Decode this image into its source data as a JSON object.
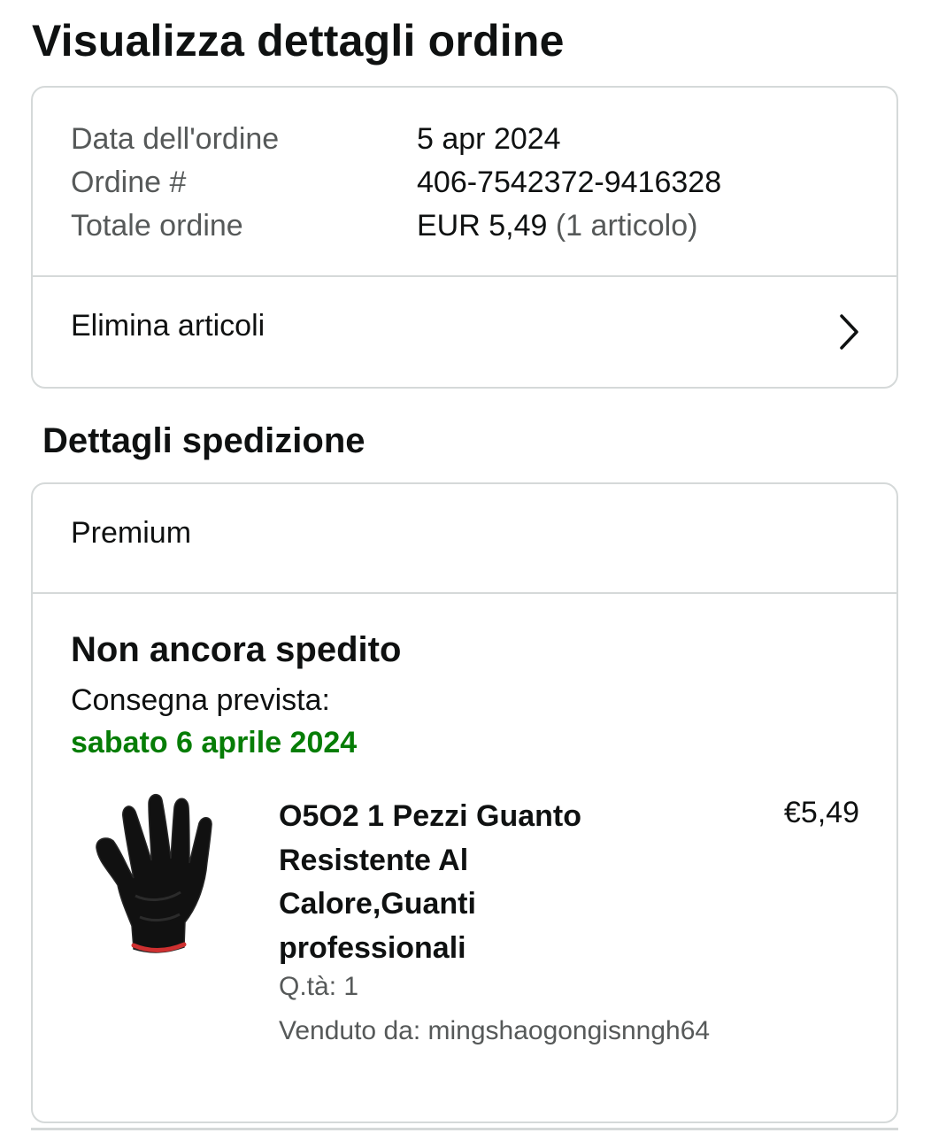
{
  "page": {
    "title": "Visualizza dettagli ordine"
  },
  "order_summary": {
    "date_label": "Data dell'ordine",
    "date_value": "5 apr 2024",
    "number_label": "Ordine #",
    "number_value": "406-7542372-9416328",
    "total_label": "Totale ordine",
    "total_value": "EUR 5,49",
    "total_items": "(1 articolo)",
    "delete_items_label": "Elimina articoli",
    "delete_chevron_icon": "chevron-right-icon"
  },
  "shipment": {
    "section_title": "Dettagli spedizione",
    "speed": "Premium",
    "status": "Non ancora spedito",
    "delivery_label": "Consegna prevista:",
    "delivery_date": "sabato 6 aprile 2024",
    "delivery_color": "#067d06",
    "item": {
      "title": "O5O2 1 Pezzi Guanto Resistente Al Calore,Guanti professionali",
      "price": "€5,49",
      "quantity": "Q.tà: 1",
      "seller": "Venduto da: mingshaogongisnngh64",
      "image_icon": "black-knit-glove-image"
    }
  }
}
